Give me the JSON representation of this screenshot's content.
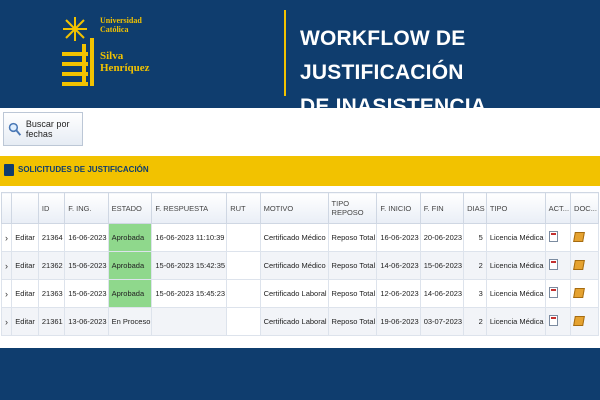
{
  "header": {
    "logo": {
      "line1": "Universidad",
      "line2": "Católica",
      "line3": "Silva",
      "line4": "Henríquez"
    },
    "title_line1": "WORKFLOW DE JUSTIFICACIÓN",
    "title_line2": "DE INASISTENCIA"
  },
  "toolbar": {
    "search_label": "Buscar por fechas"
  },
  "panel": {
    "title": "Solicitudes de justificación"
  },
  "table": {
    "columns": [
      "",
      "",
      "ID",
      "F. ING.",
      "ESTADO",
      "F. RESPUESTA",
      "RUT",
      "MOTIVO",
      "TIPO REPOSO",
      "F. INICIO",
      "F. FIN",
      "DIAS",
      "TIPO",
      "ACT...",
      "DOC..."
    ],
    "rows": [
      {
        "expand": "›",
        "edit": "Editar",
        "id": "21364",
        "f_ing": "16-06-2023",
        "estado": "Aprobada",
        "f_resp": "16-06-2023 11:10:39",
        "rut": "",
        "motivo": "Certificado Médico",
        "tipo_reposo": "Reposo Total",
        "f_inicio": "16-06-2023",
        "f_fin": "20-06-2023",
        "dias": "5",
        "tipo": "Licencia Médica"
      },
      {
        "expand": "›",
        "edit": "Editar",
        "id": "21362",
        "f_ing": "15-06-2023",
        "estado": "Aprobada",
        "f_resp": "15-06-2023 15:42:35",
        "rut": "",
        "motivo": "Certificado Médico",
        "tipo_reposo": "Reposo Total",
        "f_inicio": "14-06-2023",
        "f_fin": "15-06-2023",
        "dias": "2",
        "tipo": "Licencia Médica"
      },
      {
        "expand": "›",
        "edit": "Editar",
        "id": "21363",
        "f_ing": "15-06-2023",
        "estado": "Aprobada",
        "f_resp": "15-06-2023 15:45:23",
        "rut": "",
        "motivo": "Certificado Laboral",
        "tipo_reposo": "Reposo Total",
        "f_inicio": "12-06-2023",
        "f_fin": "14-06-2023",
        "dias": "3",
        "tipo": "Licencia Médica"
      },
      {
        "expand": "›",
        "edit": "Editar",
        "id": "21361",
        "f_ing": "13-06-2023",
        "estado": "En Proceso",
        "f_resp": "",
        "rut": "",
        "motivo": "Certificado Laboral",
        "tipo_reposo": "Reposo Total",
        "f_inicio": "19-06-2023",
        "f_fin": "03-07-2023",
        "dias": "2",
        "tipo": "Licencia Médica"
      }
    ]
  },
  "colors": {
    "navy": "#0f3d6e",
    "gold": "#f2c200",
    "approved": "#8fd88c"
  }
}
